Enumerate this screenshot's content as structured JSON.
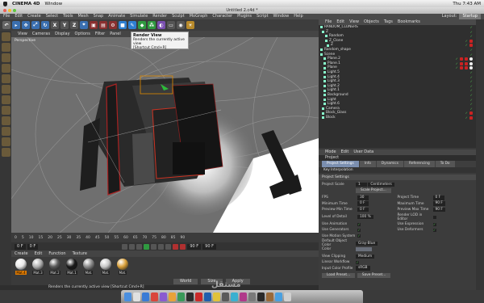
{
  "mac_menu": {
    "app": "CINEMA 4D",
    "window": "Window",
    "right": [
      "Thu 7:43 AM"
    ]
  },
  "window_title": "Untitled 2.c4d *",
  "main_menu": [
    "File",
    "Edit",
    "Create",
    "Select",
    "Tools",
    "Mesh",
    "Snap",
    "Animate",
    "Simulate",
    "Render",
    "Sculpt",
    "MoGraph",
    "Character",
    "Plugins",
    "Script",
    "Window",
    "Help"
  ],
  "layout": {
    "label": "Layout:",
    "value": "Startup"
  },
  "toolbar_icons": [
    "undo-icon",
    "select-icon",
    "move-icon",
    "scale-icon",
    "rotate-icon",
    "x-axis",
    "y-axis",
    "z-axis",
    "coord-icon",
    "render-view-icon",
    "render-picture-icon",
    "render-settings-icon",
    "cube-icon",
    "pen-icon",
    "subdiv-icon",
    "array-icon",
    "deformer-icon",
    "floor-icon",
    "camera-icon",
    "light-icon"
  ],
  "toolbar_axes": [
    "X",
    "Y",
    "Z"
  ],
  "viewport_menu": [
    "View",
    "Cameras",
    "Display",
    "Options",
    "Filter",
    "Panel"
  ],
  "viewport_label": "Perspective",
  "tooltip": {
    "title": "Render View",
    "line1": "Renders the currently active view",
    "line2": "[Shortcut Cmd+R]"
  },
  "timeline_ticks": [
    "0",
    "5",
    "10",
    "15",
    "20",
    "25",
    "30",
    "35",
    "40",
    "45",
    "50",
    "55",
    "60",
    "65",
    "70",
    "75",
    "80",
    "85",
    "90"
  ],
  "playbar": {
    "start": "0 F",
    "current": "0 F",
    "end": "90 F",
    "end2": "90 F"
  },
  "material_menu": [
    "Create",
    "Edit",
    "Function",
    "Texture"
  ],
  "materials": [
    {
      "label": "Mat.4",
      "color": "#e8e8e8",
      "selected": true
    },
    {
      "label": "Mat.3",
      "color": "#b0b0b0",
      "selected": false
    },
    {
      "label": "Mat.2",
      "color": "#5a5a5a",
      "selected": false
    },
    {
      "label": "Mat.1",
      "color": "#1a1a1a",
      "selected": false
    },
    {
      "label": "Mat.",
      "color": "#8a8a8a",
      "selected": false
    },
    {
      "label": "Mat.",
      "color": "#c8c8c8",
      "selected": false
    },
    {
      "label": "Mat.",
      "color": "#d9a03a",
      "selected": false
    }
  ],
  "coord_buttons": [
    "World",
    "Size",
    "Apply"
  ],
  "status_text": "Renders the currently active view [Shortcut Cmd+R]",
  "object_menu": [
    "File",
    "Edit",
    "View",
    "Objects",
    "Tags",
    "Bookmarks"
  ],
  "objects": [
    {
      "name": "RANDOM_CLONERS",
      "sel": false,
      "tags": 0,
      "w": 0
    },
    {
      "name": "Z",
      "sel": false,
      "tags": 0,
      "w": 0
    },
    {
      "name": "Random",
      "sel": false,
      "tags": 0,
      "w": 0
    },
    {
      "name": "Z_Clone",
      "sel": false,
      "tags": 1,
      "w": 0
    },
    {
      "name": "Z",
      "sel": false,
      "tags": 1,
      "w": 0
    },
    {
      "name": "Random_shape",
      "sel": false,
      "tags": 0,
      "w": 0
    },
    {
      "name": "Scene",
      "sel": false,
      "tags": 0,
      "w": 0
    },
    {
      "name": "Plane.2",
      "sel": false,
      "tags": 2,
      "w": 1
    },
    {
      "name": "Plane.1",
      "sel": false,
      "tags": 2,
      "w": 1
    },
    {
      "name": "Plane",
      "sel": false,
      "tags": 2,
      "w": 1
    },
    {
      "name": "Light.5",
      "sel": false,
      "tags": 0,
      "w": 0
    },
    {
      "name": "Light.4",
      "sel": false,
      "tags": 0,
      "w": 0
    },
    {
      "name": "Light.3",
      "sel": false,
      "tags": 0,
      "w": 0
    },
    {
      "name": "Light.2",
      "sel": false,
      "tags": 0,
      "w": 0
    },
    {
      "name": "Light.1",
      "sel": false,
      "tags": 0,
      "w": 0
    },
    {
      "name": "Background",
      "sel": false,
      "tags": 0,
      "w": 0
    },
    {
      "name": "Light",
      "sel": false,
      "tags": 0,
      "w": 0
    },
    {
      "name": "Light.6",
      "sel": false,
      "tags": 0,
      "w": 0
    },
    {
      "name": "Camera",
      "sel": false,
      "tags": 0,
      "w": 0
    },
    {
      "name": "Block_Glass",
      "sel": false,
      "tags": 1,
      "w": 0
    },
    {
      "name": "Block",
      "sel": false,
      "tags": 1,
      "w": 0
    }
  ],
  "attr_menu": [
    "Mode",
    "Edit",
    "User Data"
  ],
  "attr_title": "Project",
  "attr_tabs": [
    "Project Settings",
    "Info",
    "Dynamics",
    "Referencing",
    "To Do"
  ],
  "attr_subtab": "Key Interpolation",
  "attr_section": "Project Settings",
  "attrs": {
    "project_scale_label": "Project Scale",
    "project_scale": "1",
    "project_unit": "Centimeters",
    "scale_project_btn": "Scale Project...",
    "fps_label": "FPS",
    "fps": "30",
    "project_time_label": "Project Time",
    "project_time": "0 F",
    "min_time_label": "Minimum Time",
    "min_time": "0 F",
    "max_time_label": "Maximum Time",
    "max_time": "90 F",
    "prev_min_label": "Preview Min Time",
    "prev_min": "0 F",
    "prev_max_label": "Preview Max Time",
    "prev_max": "90 F",
    "lod_label": "Level of Detail",
    "lod": "100 %",
    "render_lod_label": "Render LOD in Editor",
    "use_anim_label": "Use Animation",
    "use_expr_label": "Use Expression",
    "use_gen_label": "Use Generators",
    "use_deform_label": "Use Deformers",
    "use_motion_label": "Use Motion System",
    "def_color_label": "Default Object Color",
    "def_color": "Gray-Blue",
    "color_label": "Color",
    "view_clip_label": "View Clipping",
    "view_clip": "Medium",
    "linear_label": "Linear Workflow",
    "input_profile_label": "Input Color Profile",
    "input_profile": "sRGB",
    "load_preset": "Load Preset...",
    "save_preset": "Save Preset..."
  },
  "watermark": "مستقل"
}
